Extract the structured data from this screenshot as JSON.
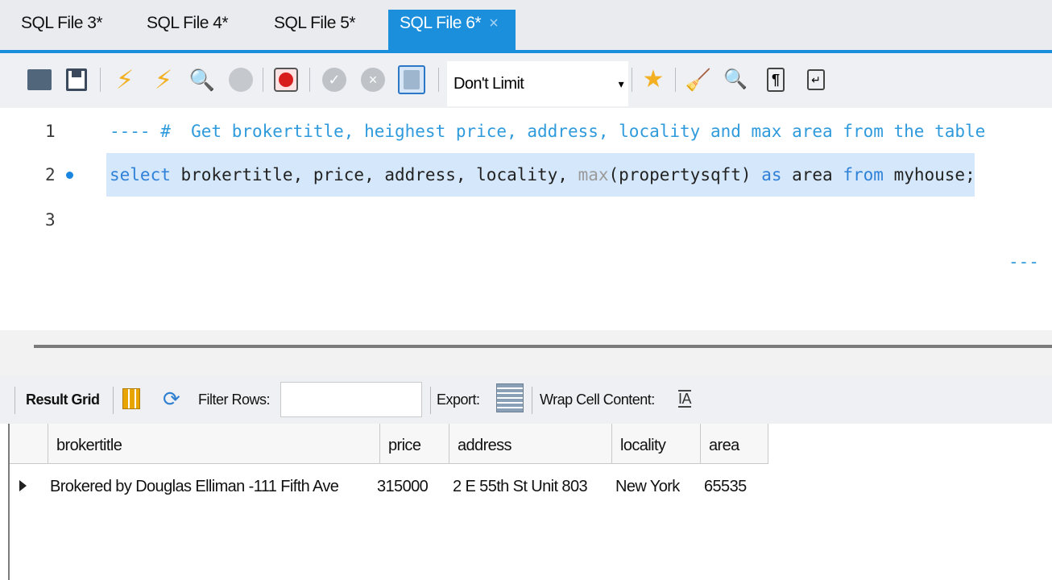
{
  "tabs": [
    {
      "label": "SQL File 3*"
    },
    {
      "label": "SQL File 4*"
    },
    {
      "label": "SQL File 5*"
    },
    {
      "label": "SQL File 6*",
      "close": "×"
    }
  ],
  "toolbar": {
    "limit_value": "Don't Limit",
    "limit_arrow": "▾",
    "icons": [
      "open-folder-icon",
      "save-icon",
      "execute-icon",
      "execute-current-icon",
      "explain-icon",
      "stop-icon",
      "error-toggle-icon",
      "commit-icon",
      "rollback-icon",
      "autocommit-toggle-icon",
      "bookmark-add-icon",
      "beautify-icon",
      "find-icon",
      "invisible-chars-icon",
      "word-wrap-icon"
    ]
  },
  "editor": {
    "lines": [
      {
        "num": "1",
        "comment": "---- #  Get brokertitle, heighest price, address, locality and max area from the table",
        "tail": "---"
      },
      {
        "num": "2",
        "tokens": [
          {
            "t": "select",
            "c": "kw"
          },
          {
            "t": " brokertitle, price, address, locality, ",
            "c": "id"
          },
          {
            "t": "max",
            "c": "fn"
          },
          {
            "t": "(propertysqft) ",
            "c": "id"
          },
          {
            "t": "as",
            "c": "kw"
          },
          {
            "t": " area ",
            "c": "id"
          },
          {
            "t": "from",
            "c": "kw"
          },
          {
            "t": " myhouse;",
            "c": "id"
          }
        ]
      },
      {
        "num": "3"
      }
    ]
  },
  "results_toolbar": {
    "result_grid": "Result Grid",
    "filter_rows": "Filter Rows:",
    "filter_value": "",
    "export": "Export:",
    "wrap_cell": "Wrap Cell Content:",
    "wrap_icon": "IA"
  },
  "grid": {
    "columns": [
      "brokertitle",
      "price",
      "address",
      "locality",
      "area"
    ],
    "rows": [
      [
        "Brokered by Douglas Elliman  -111 Fifth Ave",
        "315000",
        "2 E 55th St Unit 803",
        "New York",
        "65535"
      ]
    ]
  },
  "colors": {
    "accent": "#1c8fdc",
    "selection": "#d5e8fb"
  }
}
